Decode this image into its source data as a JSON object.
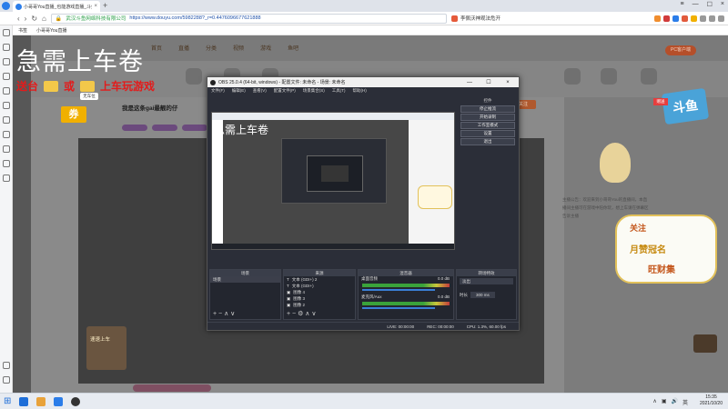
{
  "browser": {
    "tab_title": "小哥哥You直播_也能游戏直播_斗鱼",
    "tab_close": "×",
    "new_tab": "+",
    "window_controls": [
      "≡",
      "—",
      "☐",
      "×"
    ],
    "back": "‹",
    "forward": "›",
    "reload": "↻",
    "home": "⌂",
    "site_name": "武汉斗鱼网络科技有限公司",
    "url": "https://www.douyu.com/5982288?_r=0.4476096677621888",
    "right_text": "李佩沃神观法危开",
    "bookmarks": [
      "书签",
      "小哥哥You直播"
    ]
  },
  "page": {
    "menu": [
      "首页",
      "直播",
      "分类",
      "视频",
      "游戏",
      "鱼吧"
    ],
    "streamer_name": "我是这条gai最靓的仔",
    "follow_label": "关注",
    "pc_label": "PC客户端",
    "promo_text": "速速上车",
    "side_desc": "主播公告：欢迎来到小哥哥You的直播间，本直播间主播可在游戏中陪你玩，想上车请在弹幕区告诉主播"
  },
  "overlay": {
    "caption_main": "急需上车卷",
    "caption_sub_prefix": "送台",
    "caption_sub_or": "或",
    "caption_sub_suffix": "上车玩游戏",
    "ticket_label": "券",
    "small_badge": "无车位",
    "seal_text": "斗鱼",
    "seal_small": "赠送",
    "rewards": [
      "关注",
      "月赞冠名",
      "旺财集"
    ]
  },
  "obs": {
    "title": "OBS 25.0.4 (64-bit, windows) - 配置文件: 未命名 - 场景: 未命名",
    "window_controls": [
      "—",
      "☐",
      "×"
    ],
    "menu": [
      "文件(F)",
      "编辑(E)",
      "查看(V)",
      "配置文件(P)",
      "场景集合(S)",
      "工具(T)",
      "帮助(H)"
    ],
    "controls_header": "控件",
    "controls": [
      "停止推流",
      "开始录制",
      "工作室模式",
      "设置",
      "退出"
    ],
    "preview_caption": "急需上车卷",
    "docks": {
      "scenes": {
        "title": "场景",
        "items": [
          "场景"
        ]
      },
      "sources": {
        "title": "来源",
        "items": [
          "文本 (GDI+) 2",
          "文本 (GDI+)",
          "图像 4",
          "图像 3",
          "图像 2"
        ]
      },
      "mixer": {
        "title": "混音器",
        "tracks": [
          {
            "name": "桌面音频",
            "db": "0.0 dB"
          },
          {
            "name": "麦克风/Aux",
            "db": "0.0 dB"
          }
        ]
      },
      "transitions": {
        "title": "转场特效",
        "type": "淡出",
        "duration_label": "时长",
        "duration_value": "300 ms"
      }
    },
    "controls_glyphs": "+  −  ∧  ∨",
    "source_controls": "+  −  ⚙  ∧  ∨",
    "status": {
      "live": "LIVE: 00:00:00",
      "rec": "REC: 00:00:00",
      "cpu": "CPU: 1.3%, 60.00 fps"
    }
  },
  "taskbar": {
    "time": "15:35",
    "date": "2021/10/20",
    "tray": [
      "∧",
      "▣",
      "🔊",
      "英"
    ]
  },
  "colors": {
    "obs_bg": "#2b2e38",
    "accent_red": "#e31b1b",
    "ticket_yellow": "#f1b000",
    "browser_tab_bg": "#dfe3ea"
  }
}
